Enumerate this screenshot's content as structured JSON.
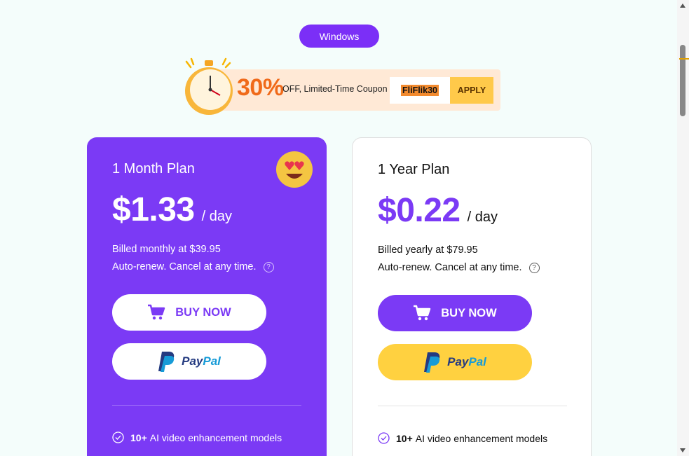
{
  "platform_tab": {
    "label": "Windows"
  },
  "coupon": {
    "discount": "30%",
    "text": "OFF, Limited-Time Coupon",
    "code": "FliFlik30",
    "apply_label": "APPLY"
  },
  "plans": [
    {
      "name": "1 Month Plan",
      "price": "$1.33",
      "per": "/ day",
      "billed": "Billed monthly at $39.95",
      "renew": "Auto-renew. Cancel at any time.",
      "buy_label": "BUY NOW",
      "paypal_a": "Pay",
      "paypal_b": "Pal",
      "feature_bold": "10+",
      "feature_text": "AI video enhancement models"
    },
    {
      "name": "1 Year Plan",
      "price": "$0.22",
      "per": "/ day",
      "billed": "Billed yearly at $79.95",
      "renew": "Auto-renew. Cancel at any time.",
      "buy_label": "BUY NOW",
      "paypal_a": "Pay",
      "paypal_b": "Pal",
      "feature_bold": "10+",
      "feature_text": "AI video enhancement models"
    }
  ],
  "colors": {
    "accent": "#7b3af5",
    "coupon_orange": "#f06a1a",
    "paypal_yellow": "#ffd140"
  },
  "icons": [
    "alarm-clock-icon",
    "heart-eyes-emoji-icon",
    "cart-icon",
    "paypal-logo-icon",
    "help-icon",
    "check-circle-icon"
  ]
}
